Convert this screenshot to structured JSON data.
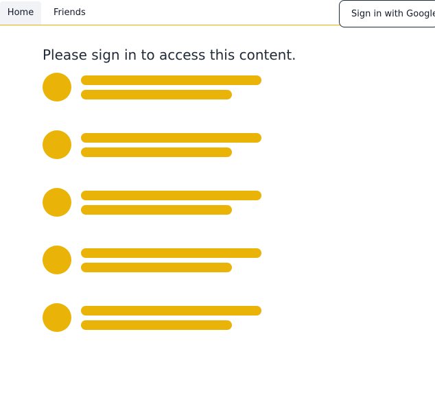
{
  "nav": {
    "items": [
      {
        "label": "Home",
        "active": true
      },
      {
        "label": "Friends",
        "active": false
      }
    ],
    "signin_label": "Sign in with Google"
  },
  "main": {
    "message": "Please sign in to access this content.",
    "placeholder_count": 5
  },
  "colors": {
    "accent": "#eab308",
    "active_tab_bg": "#f1f3f7",
    "text": "#111827"
  }
}
